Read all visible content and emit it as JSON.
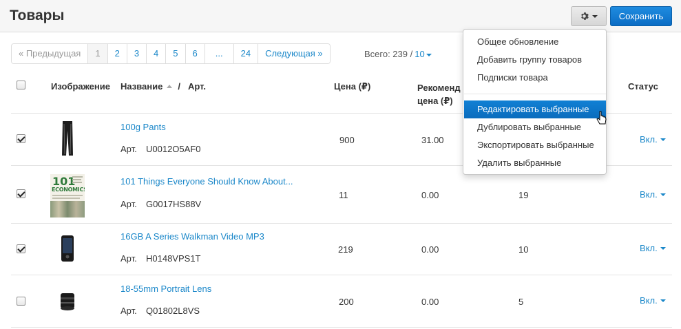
{
  "header": {
    "title": "Товары",
    "save_label": "Сохранить"
  },
  "pagination": {
    "prev": "« Предыдущая",
    "pages": [
      "1",
      "2",
      "3",
      "4",
      "5",
      "6",
      "...",
      "24"
    ],
    "next": "Следующая »",
    "total_label": "Всего: 239 /",
    "per_page": "10"
  },
  "table": {
    "headers": {
      "image": "Изображение",
      "name": "Название",
      "separator": "/",
      "art": "Арт.",
      "price": "Цена (₽)",
      "recommended_line1": "Рекоменд",
      "recommended_line2": "цена (₽)",
      "status": "Статус"
    },
    "rows": [
      {
        "checked": true,
        "name": "100g Pants",
        "art_label": "Арт.",
        "art": "U0012O5AF0",
        "price": "900",
        "recommended": "31.00",
        "quantity": "",
        "status": "Вкл."
      },
      {
        "checked": true,
        "name": "101 Things Everyone Should Know About...",
        "art_label": "Арт.",
        "art": "G0017HS88V",
        "price": "11",
        "recommended": "0.00",
        "quantity": "19",
        "status": "Вкл."
      },
      {
        "checked": true,
        "name": "16GB A Series Walkman Video MP3",
        "art_label": "Арт.",
        "art": "H0148VPS1T",
        "price": "219",
        "recommended": "0.00",
        "quantity": "10",
        "status": "Вкл."
      },
      {
        "checked": false,
        "name": "18-55mm Portrait Lens",
        "art_label": "Арт.",
        "art": "Q01802L8VS",
        "price": "200",
        "recommended": "0.00",
        "quantity": "5",
        "status": "Вкл."
      }
    ]
  },
  "book_cover": {
    "line1": "101",
    "line2": "ECONOMICS"
  },
  "dropdown": {
    "items_top": [
      "Общее обновление",
      "Добавить группу товаров",
      "Подписки товара"
    ],
    "items_bottom": [
      "Редактировать выбранные",
      "Дублировать выбранные",
      "Экспортировать выбранные",
      "Удалить выбранные"
    ],
    "highlighted": "Редактировать выбранные"
  },
  "colors": {
    "link": "#1a87c9",
    "primary": "#0b6cc4",
    "highlight": "#0a6cbd"
  }
}
